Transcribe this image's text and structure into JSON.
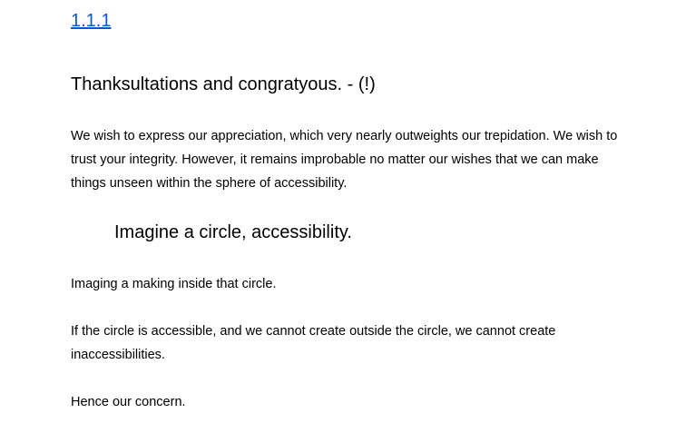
{
  "document": {
    "section_link": "1.1.1",
    "heading": "Thanksultations and congratyous. - (!)",
    "paragraph_1": "We wish to express our appreciation, which very nearly outweights our trepidation. We wish to trust your integrity. However, it remains improbable no matter our wishes that we can make things unseen within the sphere of accessibility.",
    "subheading": "Imagine a circle, accessibility.",
    "paragraph_2": "Imaging a making inside that circle.",
    "paragraph_3": "If the circle is accessible, and we cannot create outside the circle, we cannot create inaccessibilities.",
    "paragraph_4": "Hence our concern."
  },
  "colors": {
    "link": "#1155cc",
    "text": "#000000",
    "background": "#ffffff"
  }
}
